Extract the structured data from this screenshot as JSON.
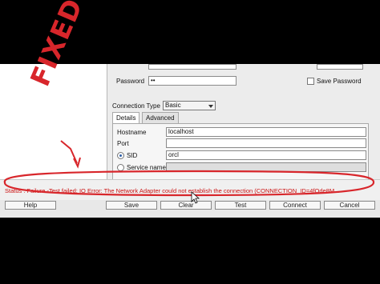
{
  "credentials": {
    "password_label": "Password",
    "password_value": "••",
    "save_password_label": "Save Password"
  },
  "connection": {
    "type_label": "Connection Type",
    "type_value": "Basic"
  },
  "tabs": [
    {
      "label": "Details"
    },
    {
      "label": "Advanced"
    }
  ],
  "details": {
    "hostname_label": "Hostname",
    "hostname_value": "localhost",
    "port_label": "Port",
    "sid_label": "SID",
    "sid_value": "orcl",
    "service_name_label": "Service name"
  },
  "status_text": "Status : Failure -Test failed: IO Error: The Network Adapter could not establish the connection (CONNECTION_ID=4fOde8M...",
  "buttons": {
    "help": "Help",
    "save": "Save",
    "clear": "Clear",
    "test": "Test",
    "connect": "Connect",
    "cancel": "Cancel"
  },
  "annotation": {
    "stamp_text": "FIXED",
    "color": "#d8262b"
  }
}
